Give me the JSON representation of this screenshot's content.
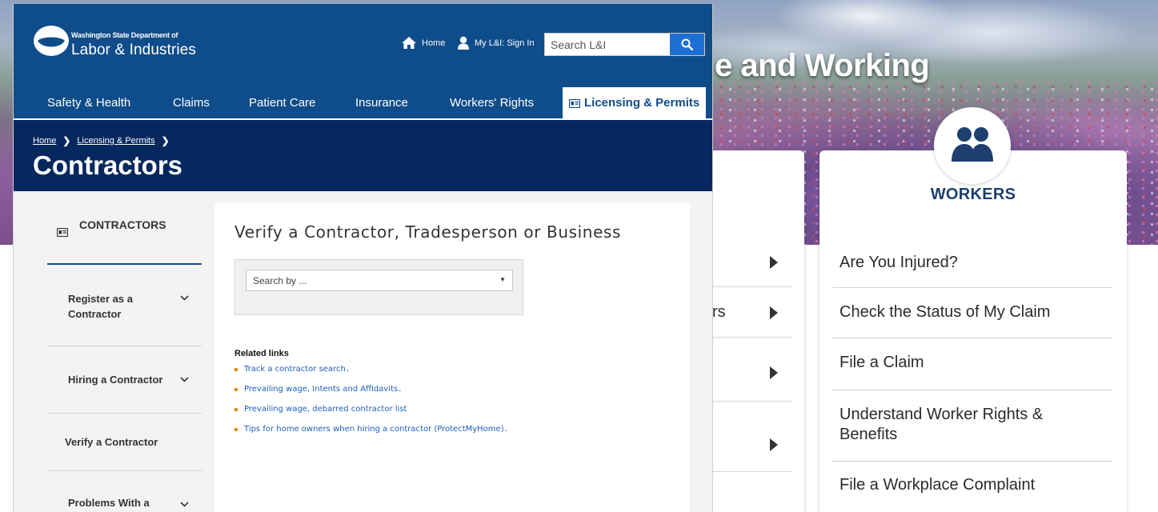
{
  "background_page": {
    "hero_title": "e and Working",
    "left_card_fragments": [
      "rs"
    ],
    "workers": {
      "title": "WORKERS",
      "items": [
        "Are You Injured?",
        "Check the Status of My Claim",
        "File a Claim",
        "Understand Worker Rights & Benefits",
        "File a Workplace Complaint"
      ]
    }
  },
  "header": {
    "logo_dept": "Washington State Department of",
    "logo_name": "Labor & Industries",
    "home_link": "Home",
    "signin_link": "My L&I: Sign In",
    "search_placeholder": "Search L&I"
  },
  "nav": {
    "items": [
      "Safety & Health",
      "Claims",
      "Patient Care",
      "Insurance",
      "Workers' Rights",
      "Licensing & Permits"
    ],
    "active": "Licensing & Permits"
  },
  "breadcrumb": [
    "Home",
    "Licensing & Permits"
  ],
  "page_title": "Contractors",
  "sidenav": {
    "heading": "CONTRACTORS",
    "items": [
      "Register as a Contractor",
      "Hiring a Contractor",
      "Verify a Contractor",
      "Problems With a"
    ]
  },
  "content": {
    "heading": "Verify a Contractor, Tradesperson or Business",
    "select_value": "Search by ...",
    "related_title": "Related links",
    "related_links": [
      "Track a contractor search",
      "Prevailing wage, Intents and Affidavits",
      "Prevailing wage, debarred contractor list",
      "Tips for home owners when hiring a contractor (ProtectMyHome)"
    ]
  },
  "colors": {
    "header_blue": "#0f4c8a",
    "banner_navy": "#04285e",
    "search_button": "#1d6fd3",
    "link_blue": "#1d5fbf",
    "bullet_orange": "#d98c1a"
  }
}
